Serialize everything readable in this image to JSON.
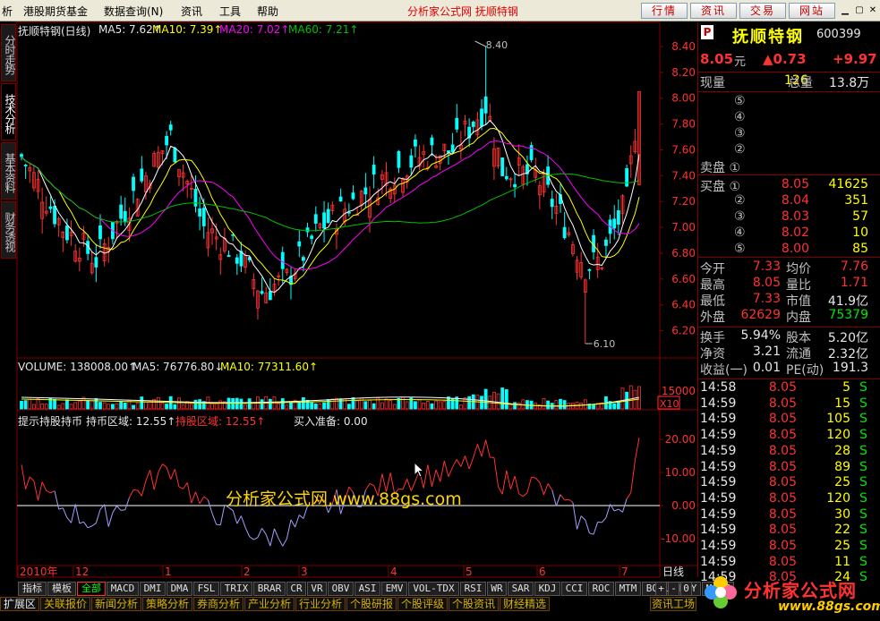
{
  "menu": {
    "items": [
      "析",
      "港股期货基金",
      "数据查询(N)",
      "资讯",
      "工具",
      "帮助"
    ],
    "title": "分析家公式网 抚顺特钢",
    "buttons": [
      "行情",
      "资讯",
      "交易",
      "网站"
    ]
  },
  "lefttabs": [
    "分时走势",
    "技术分析",
    "基本资料",
    "财务透视"
  ],
  "main": {
    "header": {
      "name": "抚顺特钢(日线)",
      "ma5": "MA5: 7.62↑",
      "ma10": "MA10: 7.39↑",
      "ma20": "MA20: 7.02↑",
      "ma60": "MA60: 7.21↑"
    },
    "high_label": "8.40",
    "low_label": "6.10",
    "y_ticks": [
      "8.40",
      "8.20",
      "8.00",
      "7.80",
      "7.60",
      "7.40",
      "7.20",
      "7.00",
      "6.80",
      "6.60",
      "6.40",
      "6.20"
    ],
    "volume": {
      "header": "VOLUME: 138008.00↑",
      "ma5": "MA5: 76776.80↓",
      "ma10": "MA10: 77311.60↑",
      "tick": "15000",
      "unit": "X10"
    },
    "indicator": {
      "name": "提示持股持币",
      "region1": "持币区域: 12.55↑",
      "region2": "持股区域: 12.55↑",
      "buy": "买入准备: 0.00",
      "ticks": [
        "20.00",
        "10.00",
        "0.00",
        "-10.00"
      ]
    },
    "watermark": "分析家公式网,www.88gs.com",
    "x_labels": [
      "2010年",
      "12",
      "1",
      "2",
      "3",
      "4",
      "5",
      "6",
      "7"
    ],
    "period": "日线"
  },
  "quote": {
    "code_badge": "P",
    "name": "抚顺特钢",
    "code": "600399",
    "price": "8.05",
    "unit": "元",
    "change": "▲0.73",
    "change_pct": "+9.97",
    "now_vol_label": "现量",
    "now_vol": "126",
    "total_vol_label": "总量",
    "total_vol": "13.8万",
    "sell": [
      {
        "label": "⑤",
        "price": "",
        "vol": ""
      },
      {
        "label": "④",
        "price": "",
        "vol": ""
      },
      {
        "label": "③",
        "price": "",
        "vol": ""
      },
      {
        "label": "②",
        "price": "",
        "vol": ""
      },
      {
        "label": "卖盘 ①",
        "price": "",
        "vol": ""
      }
    ],
    "buy": [
      {
        "label": "买盘 ①",
        "price": "8.05",
        "vol": "41625"
      },
      {
        "label": "②",
        "price": "8.04",
        "vol": "351"
      },
      {
        "label": "③",
        "price": "8.03",
        "vol": "57"
      },
      {
        "label": "④",
        "price": "8.02",
        "vol": "10"
      },
      {
        "label": "⑤",
        "price": "8.00",
        "vol": "85"
      }
    ],
    "stats": [
      {
        "l1": "今开",
        "v1": "7.33",
        "l2": "均价",
        "v2": "7.76"
      },
      {
        "l1": "最高",
        "v1": "8.05",
        "l2": "量比",
        "v2": "1.71"
      },
      {
        "l1": "最低",
        "v1": "7.33",
        "l2": "市值",
        "v2": "41.9亿"
      },
      {
        "l1": "外盘",
        "v1": "62629",
        "l2": "内盘",
        "v2": "75379"
      }
    ],
    "fin": [
      {
        "l1": "换手",
        "v1": "5.94%",
        "l2": "股本",
        "v2": "5.20亿"
      },
      {
        "l1": "净资",
        "v1": "3.21",
        "l2": "流通",
        "v2": "2.32亿"
      },
      {
        "l1": "收益(一)",
        "v1": "0.01",
        "l2": "PE(动)",
        "v2": "191.3"
      }
    ],
    "ticks": [
      {
        "t": "14:58",
        "p": "8.05",
        "v": "5",
        "s": "S"
      },
      {
        "t": "14:59",
        "p": "8.05",
        "v": "15",
        "s": "S"
      },
      {
        "t": "14:59",
        "p": "8.05",
        "v": "105",
        "s": "S"
      },
      {
        "t": "14:59",
        "p": "8.05",
        "v": "120",
        "s": "S"
      },
      {
        "t": "14:59",
        "p": "8.05",
        "v": "28",
        "s": "S"
      },
      {
        "t": "14:59",
        "p": "8.05",
        "v": "89",
        "s": "S"
      },
      {
        "t": "14:59",
        "p": "8.05",
        "v": "25",
        "s": "S"
      },
      {
        "t": "14:59",
        "p": "8.05",
        "v": "120",
        "s": "S"
      },
      {
        "t": "14:59",
        "p": "8.05",
        "v": "30",
        "s": "S"
      },
      {
        "t": "14:59",
        "p": "8.05",
        "v": "22",
        "s": "S"
      },
      {
        "t": "14:59",
        "p": "8.05",
        "v": "25",
        "s": "S"
      },
      {
        "t": "14:59",
        "p": "8.05",
        "v": "11",
        "s": "S"
      },
      {
        "t": "14:59",
        "p": "8.05",
        "v": "24",
        "s": "S"
      }
    ]
  },
  "bottom": {
    "indicators": [
      "指标",
      "模板",
      "全部",
      "MACD",
      "DMI",
      "DMA",
      "FSL",
      "TRIX",
      "BRAR",
      "CR",
      "VR",
      "OBV",
      "ASI",
      "EMV",
      "VOL-TDX",
      "RSI",
      "WR",
      "SAR",
      "KDJ",
      "CCI",
      "ROC",
      "MTM",
      "BOLL",
      "PSY",
      "MCST"
    ],
    "controls": [
      "+",
      "-",
      "0"
    ],
    "tabs": [
      "扩展区",
      "关联报价",
      "新闻分析",
      "策略分析",
      "券商分析",
      "产业分析",
      "行业分析",
      "个股研报",
      "个股评级",
      "个股资讯",
      "财经精选"
    ],
    "right_tab": "资讯工场",
    "logo_text": "分析家公式网",
    "logo_url": "www.88gs.com"
  },
  "colors": {
    "up": "#ff3232",
    "down": "#00ffff",
    "ma5": "#ffffff",
    "ma10": "#ffff00",
    "ma20": "#ff00ff",
    "ma60": "#00c000",
    "grid": "#800000"
  }
}
